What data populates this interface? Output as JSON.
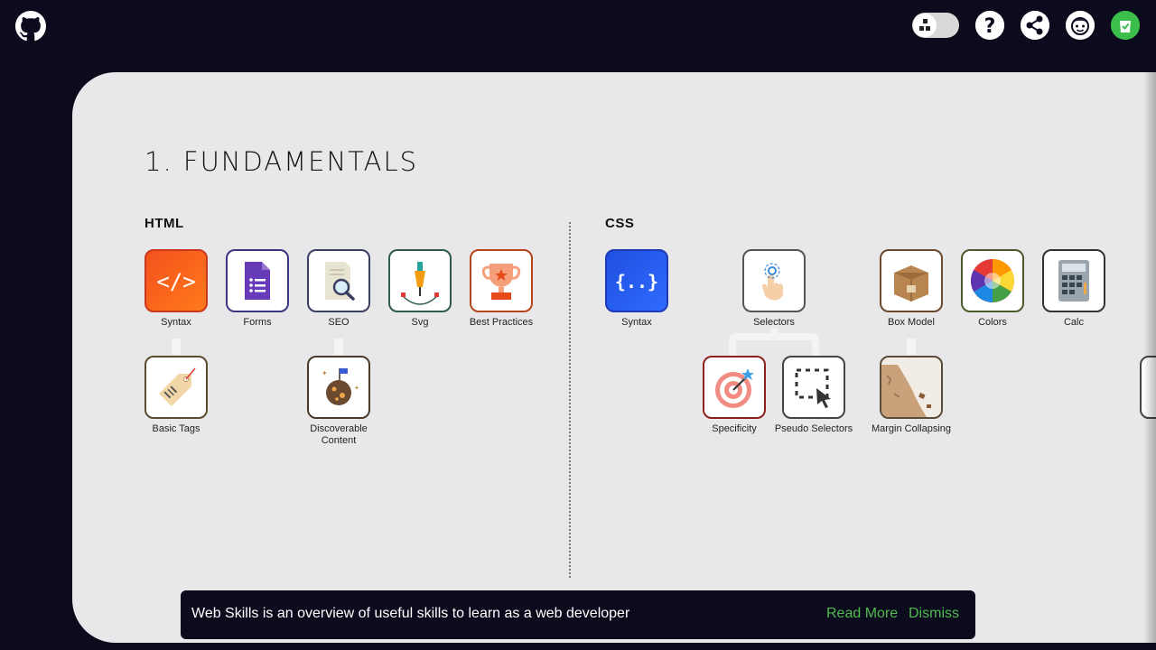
{
  "header": {
    "github_icon": "github-icon",
    "right_icons": [
      "theme-toggle",
      "help-icon",
      "share-icon",
      "avatar-icon",
      "collection-icon"
    ]
  },
  "section": {
    "title": "1. FUNDAMENTALS"
  },
  "groups": {
    "html": {
      "title": "HTML"
    },
    "css": {
      "title": "CSS"
    }
  },
  "skills": {
    "html_syntax": "Syntax",
    "forms": "Forms",
    "seo": "SEO",
    "svg": "Svg",
    "best_practices": "Best Practices",
    "basic_tags": "Basic Tags",
    "discoverable_content": "Discoverable Content",
    "css_syntax": "Syntax",
    "selectors": "Selectors",
    "box_model": "Box Model",
    "colors": "Colors",
    "calc": "Calc",
    "specificity": "Specificity",
    "pseudo_selectors": "Pseudo Selectors",
    "margin_collapsing": "Margin Collapsing"
  },
  "toast": {
    "message": "Web Skills is an overview of useful skills to learn as a web developer",
    "read_more": "Read More",
    "dismiss": "Dismiss"
  },
  "colors": {
    "background": "#0c0b1e",
    "panel": "#e8e8ea",
    "accent_green": "#4fbb4f"
  }
}
